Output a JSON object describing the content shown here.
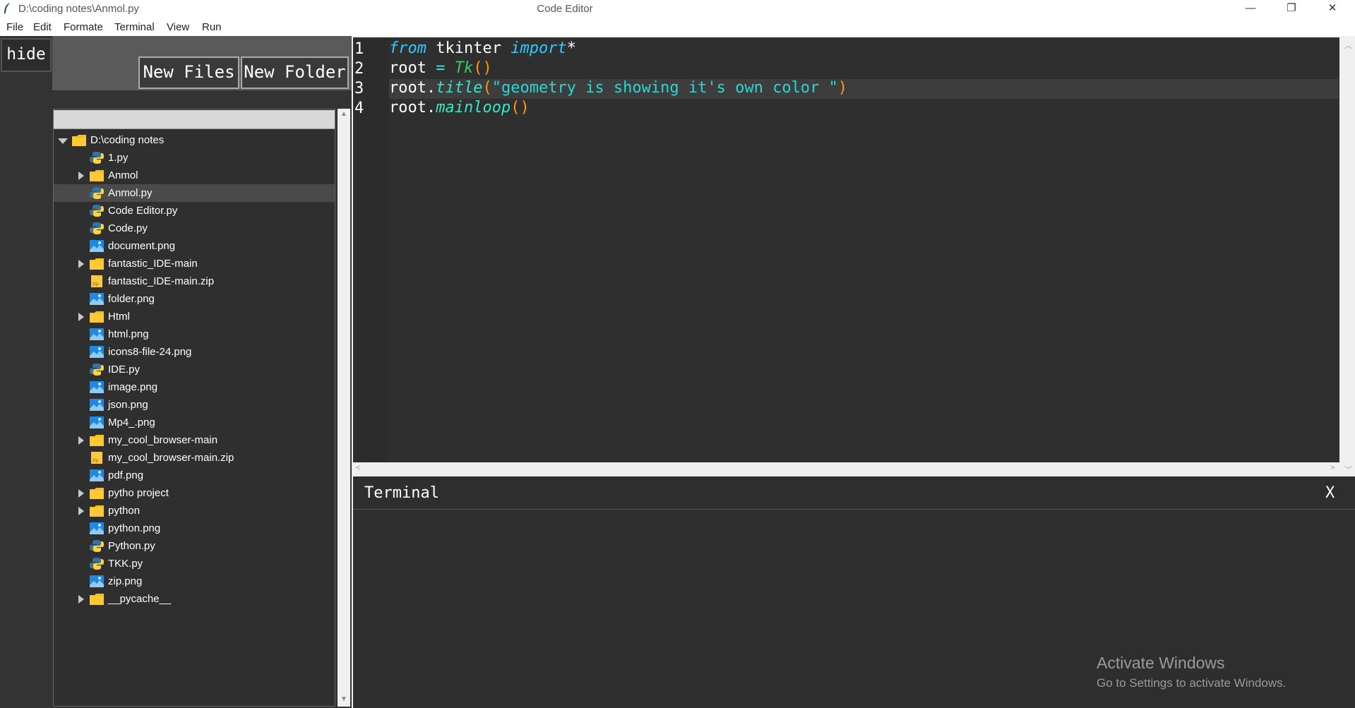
{
  "window": {
    "path": "D:\\coding notes\\Anmol.py",
    "title": "Code Editor",
    "minimize": "—",
    "restore": "❐",
    "close": "✕"
  },
  "menu": [
    "File",
    "Edit",
    "Formate",
    "Terminal",
    "View",
    "Run"
  ],
  "sidebar": {
    "hide_label": "hide",
    "new_files_label": "New Files",
    "new_folder_label": "New Folder"
  },
  "tree": {
    "root": "D:\\coding notes",
    "items": [
      {
        "label": "1.py",
        "type": "py",
        "folder": false
      },
      {
        "label": "Anmol",
        "type": "folder",
        "folder": true
      },
      {
        "label": "Anmol.py",
        "type": "py",
        "folder": false,
        "selected": true
      },
      {
        "label": "Code Editor.py",
        "type": "py",
        "folder": false
      },
      {
        "label": "Code.py",
        "type": "py",
        "folder": false
      },
      {
        "label": "document.png",
        "type": "png",
        "folder": false
      },
      {
        "label": "fantastic_IDE-main",
        "type": "folder",
        "folder": true
      },
      {
        "label": "fantastic_IDE-main.zip",
        "type": "zip",
        "folder": false
      },
      {
        "label": "folder.png",
        "type": "png",
        "folder": false
      },
      {
        "label": "Html",
        "type": "folder",
        "folder": true
      },
      {
        "label": "html.png",
        "type": "png",
        "folder": false
      },
      {
        "label": "icons8-file-24.png",
        "type": "png",
        "folder": false
      },
      {
        "label": "IDE.py",
        "type": "py",
        "folder": false
      },
      {
        "label": "image.png",
        "type": "png",
        "folder": false
      },
      {
        "label": "json.png",
        "type": "png",
        "folder": false
      },
      {
        "label": "Mp4_.png",
        "type": "png",
        "folder": false
      },
      {
        "label": "my_cool_browser-main",
        "type": "folder",
        "folder": true
      },
      {
        "label": "my_cool_browser-main.zip",
        "type": "zip",
        "folder": false
      },
      {
        "label": "pdf.png",
        "type": "png",
        "folder": false
      },
      {
        "label": "pytho project",
        "type": "folder",
        "folder": true
      },
      {
        "label": "python",
        "type": "folder",
        "folder": true
      },
      {
        "label": "python.png",
        "type": "png",
        "folder": false
      },
      {
        "label": "Python.py",
        "type": "py",
        "folder": false
      },
      {
        "label": "TKK.py",
        "type": "py",
        "folder": false
      },
      {
        "label": "zip.png",
        "type": "png",
        "folder": false
      },
      {
        "label": "__pycache__",
        "type": "folder",
        "folder": true
      }
    ]
  },
  "editor": {
    "line_numbers": [
      "1",
      "2",
      "3",
      "4"
    ],
    "lines": [
      {
        "kw1": "from",
        "t1": " tkinter ",
        "kw2": "import",
        "t2": "*"
      },
      {
        "t1": "root ",
        "op": "=",
        "t2": " ",
        "cls": "Tk",
        "p": "()"
      },
      {
        "t1": "root.",
        "fn": "title",
        "p1": "(",
        "str": "\"geometry is showing it's own color \"",
        "p2": ")"
      },
      {
        "t1": "root.",
        "fn": "mainloop",
        "p": "()"
      }
    ]
  },
  "terminal": {
    "title": "Terminal",
    "close_label": "X"
  },
  "watermark": {
    "line1": "Activate Windows",
    "line2": "Go to Settings to activate Windows."
  },
  "colors": {
    "panel": "#2f2f2f",
    "keyword": "#2ec9ff",
    "function": "#2ee8c8",
    "class": "#33cc66",
    "string": "#28d8d0",
    "paren": "#ff9900",
    "folder": "#f5c02a"
  }
}
